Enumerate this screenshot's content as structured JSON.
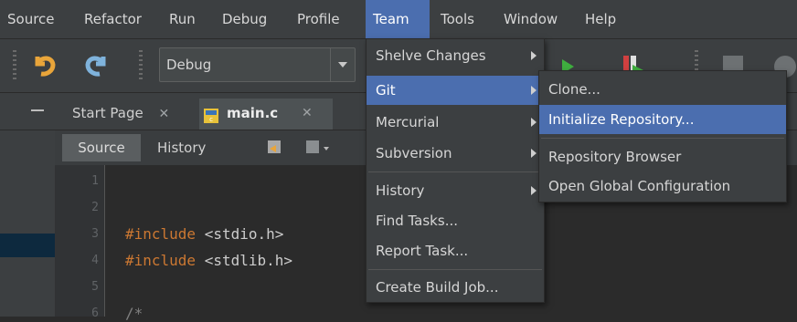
{
  "menubar": {
    "items": [
      {
        "label": "Source",
        "key": "source"
      },
      {
        "label": "Refactor",
        "key": "refactor"
      },
      {
        "label": "Run",
        "key": "run"
      },
      {
        "label": "Debug",
        "key": "debug"
      },
      {
        "label": "Profile",
        "key": "profile"
      },
      {
        "label": "Team",
        "key": "team"
      },
      {
        "label": "Tools",
        "key": "tools"
      },
      {
        "label": "Window",
        "key": "window"
      },
      {
        "label": "Help",
        "key": "help"
      }
    ]
  },
  "toolbar": {
    "config_value": "Debug",
    "icons": [
      "undo-icon",
      "redo-icon",
      "run-icon",
      "debug-run-icon",
      "panel-icon",
      "gear-icon"
    ]
  },
  "tabs": {
    "start_page": "Start Page",
    "main_file": "main.c",
    "close_glyph": "✕"
  },
  "editor_toolbar": {
    "source_label": "Source",
    "history_label": "History"
  },
  "editor": {
    "line_numbers": [
      "1",
      "2",
      "3",
      "4",
      "5",
      "6"
    ],
    "lines": [
      {
        "directive": "",
        "rest": ""
      },
      {
        "directive": "",
        "rest": ""
      },
      {
        "directive": "#include",
        "rest": " <stdio.h>"
      },
      {
        "directive": "#include",
        "rest": " <stdlib.h>"
      },
      {
        "directive": "",
        "rest": ""
      },
      {
        "directive": "",
        "rest": "/*"
      }
    ]
  },
  "team_menu": {
    "items": [
      {
        "label": "Shelve Changes",
        "submenu": true
      },
      {
        "label": "Git",
        "submenu": true,
        "selected": true
      },
      {
        "label": "Mercurial",
        "submenu": true
      },
      {
        "label": "Subversion",
        "submenu": true
      },
      {
        "label": "History",
        "submenu": true
      },
      {
        "label": "Find Tasks...",
        "submenu": false
      },
      {
        "label": "Report Task...",
        "submenu": false
      },
      {
        "label": "Create Build Job...",
        "submenu": false
      }
    ]
  },
  "git_menu": {
    "items": [
      {
        "label": "Clone..."
      },
      {
        "label": "Initialize Repository...",
        "selected": true
      },
      {
        "label": "Repository Browser"
      },
      {
        "label": "Open Global Configuration"
      }
    ]
  },
  "colors": {
    "accent": "#4b6eaf",
    "menu_bg": "#3c3f41",
    "editor_bg": "#2b2b2b"
  }
}
